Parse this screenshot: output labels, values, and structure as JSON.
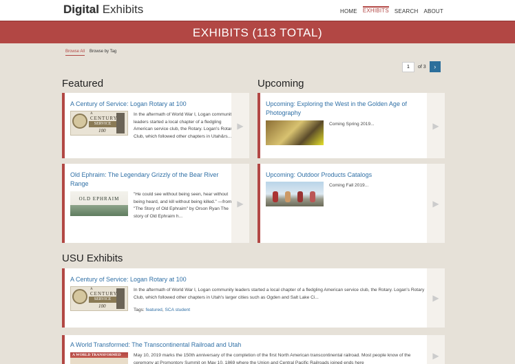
{
  "header": {
    "logo_first": "Digital",
    "logo_second": "Exhibits",
    "nav": [
      "HOME",
      "EXHIBITS",
      "SEARCH",
      "ABOUT"
    ]
  },
  "banner": {
    "title": "EXHIBITS (113 TOTAL)"
  },
  "tabs": [
    "Browse All",
    "Browse by Tag"
  ],
  "pager": {
    "current": "1",
    "of_label": "of 3",
    "next": "›"
  },
  "featured": {
    "heading": "Featured",
    "items": [
      {
        "title": "A Century of Service: Logan Rotary at 100",
        "description": "In the aftermath of World War I, Logan community leaders started a local chapter of a fledgling American service club, the Rotary. Logan's Rotary Club, which followed other chapters in Utah&rs...",
        "thumb_lines": [
          "A",
          "CENTURY",
          "SERVICE",
          "100"
        ]
      },
      {
        "title": "Old Ephraim: The Legendary Grizzly of the Bear River Range",
        "description": "\"He could see without being seen, hear without being heard, and kill without being killed.\" —from \"The Story of Old Ephraim\" by Orson Ryan The story of Old Ephraim h...",
        "thumb_text": "OLD EPHRAIM"
      }
    ]
  },
  "upcoming": {
    "heading": "Upcoming",
    "items": [
      {
        "title": "Upcoming: Exploring the West in the Golden Age of Photography",
        "description": "Coming Spring 2019..."
      },
      {
        "title": "Upcoming: Outdoor Products Catalogs",
        "description": "Coming Fall 2019..."
      }
    ]
  },
  "usu": {
    "heading": "USU Exhibits",
    "items": [
      {
        "title": "A Century of Service: Logan Rotary at 100",
        "description": "In the aftermath of World War I, Logan community leaders started a local chapter of a fledgling American service club, the Rotary. Logan's Rotary Club, which followed other chapters in Utah's larger cities such as Ogden and Salt Lake Ci...",
        "tags_label": "Tags:",
        "tags": [
          "featured",
          "SCA student"
        ],
        "thumb_lines": [
          "A",
          "CENTURY",
          "SERVICE",
          "100"
        ]
      },
      {
        "title": "A World Transformed: The Transcontinental Railroad and Utah",
        "description": "May 10, 2019 marks the 150th anniversary of the completion of the first North American transcontinental railroad. Most people know of the ceremony at Promontory Summit on May 10, 1869 where the Union and Central Pacific Railroads joined ends here",
        "thumb_text": "A WORLD TRANSFORMED"
      }
    ]
  }
}
